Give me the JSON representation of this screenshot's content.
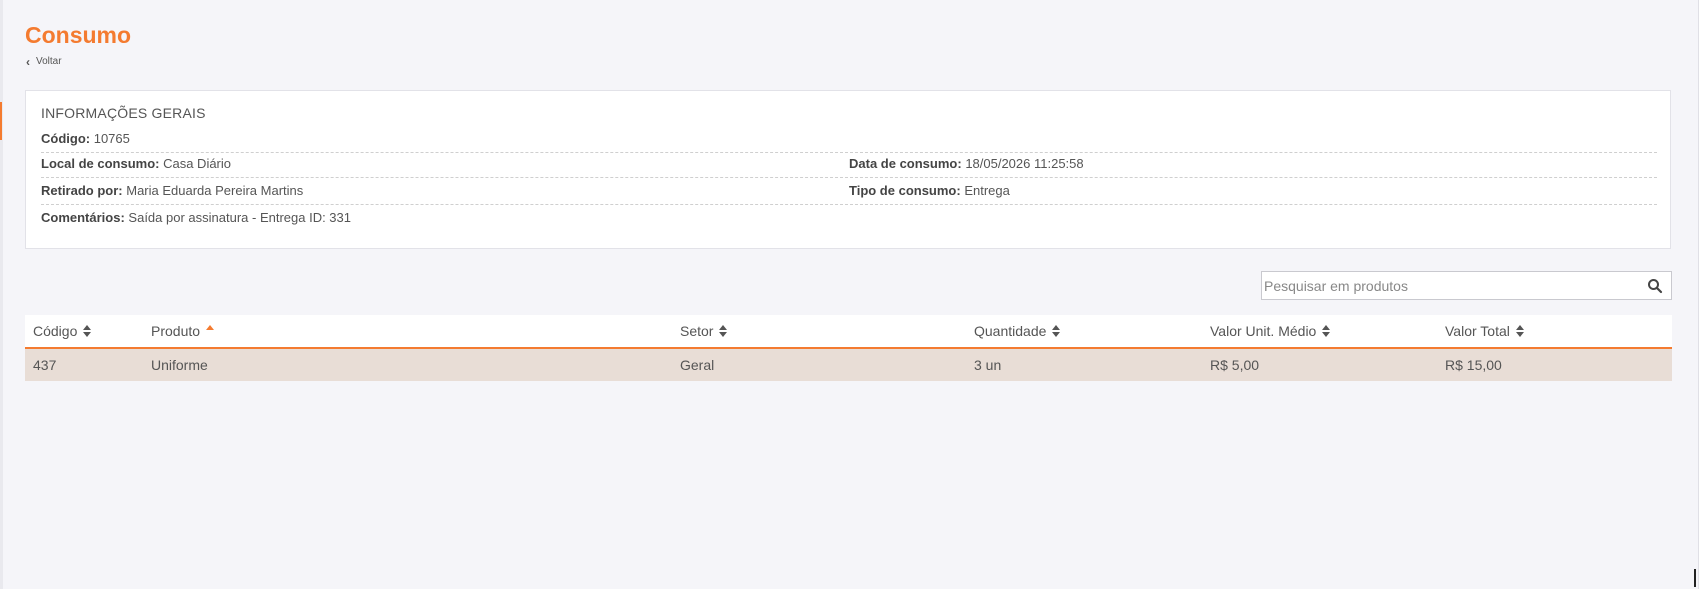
{
  "page": {
    "title": "Consumo",
    "back_label": "Voltar"
  },
  "info": {
    "heading": "INFORMAÇÕES GERAIS",
    "codigo_label": "Código:",
    "codigo_value": "10765",
    "local_label": "Local de consumo:",
    "local_value": "Casa Diário",
    "data_label": "Data de consumo:",
    "data_value": "18/05/2026 11:25:58",
    "retirado_label": "Retirado por:",
    "retirado_value": "Maria Eduarda Pereira Martins",
    "tipo_label": "Tipo de consumo:",
    "tipo_value": "Entrega",
    "comentarios_label": "Comentários:",
    "comentarios_value": "Saída por assinatura - Entrega ID: 331"
  },
  "search": {
    "placeholder": "Pesquisar em produtos",
    "value": ""
  },
  "table": {
    "columns": [
      {
        "label": "Código",
        "sort": "none"
      },
      {
        "label": "Produto",
        "sort": "asc"
      },
      {
        "label": "Setor",
        "sort": "none"
      },
      {
        "label": "Quantidade",
        "sort": "none"
      },
      {
        "label": "Valor Unit. Médio",
        "sort": "none"
      },
      {
        "label": "Valor Total",
        "sort": "none"
      }
    ],
    "rows": [
      [
        "437",
        "Uniforme",
        "Geral",
        "3 un",
        "R$ 5,00",
        "R$ 15,00"
      ]
    ]
  },
  "colors": {
    "accent": "#f47b30",
    "row_background": "#e8ddd6",
    "page_background": "#f5f5f9"
  },
  "icons": {
    "back": "chevron-left-icon",
    "search": "search-icon",
    "sort": "sort-icon"
  }
}
